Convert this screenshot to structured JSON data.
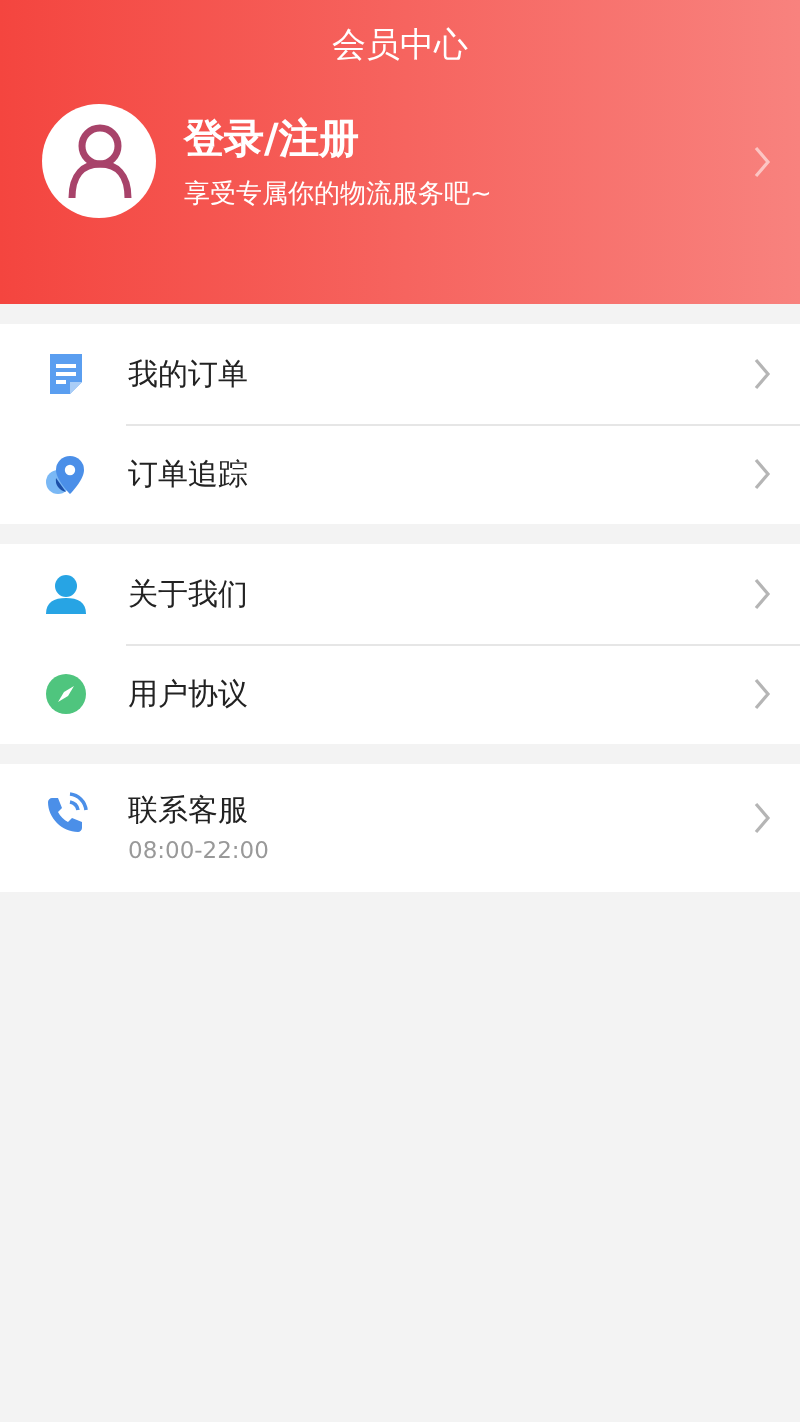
{
  "title": "会员中心",
  "profile": {
    "name": "登录/注册",
    "tagline": "享受专属你的物流服务吧~"
  },
  "groups": [
    {
      "items": [
        {
          "kind": "document",
          "label": "我的订单"
        },
        {
          "kind": "pin",
          "label": "订单追踪"
        }
      ]
    },
    {
      "items": [
        {
          "kind": "person",
          "label": "关于我们"
        },
        {
          "kind": "compass",
          "label": "用户协议"
        }
      ]
    },
    {
      "items": [
        {
          "kind": "phone",
          "label": "联系客服",
          "subtitle": "08:00-22:00"
        }
      ]
    }
  ]
}
